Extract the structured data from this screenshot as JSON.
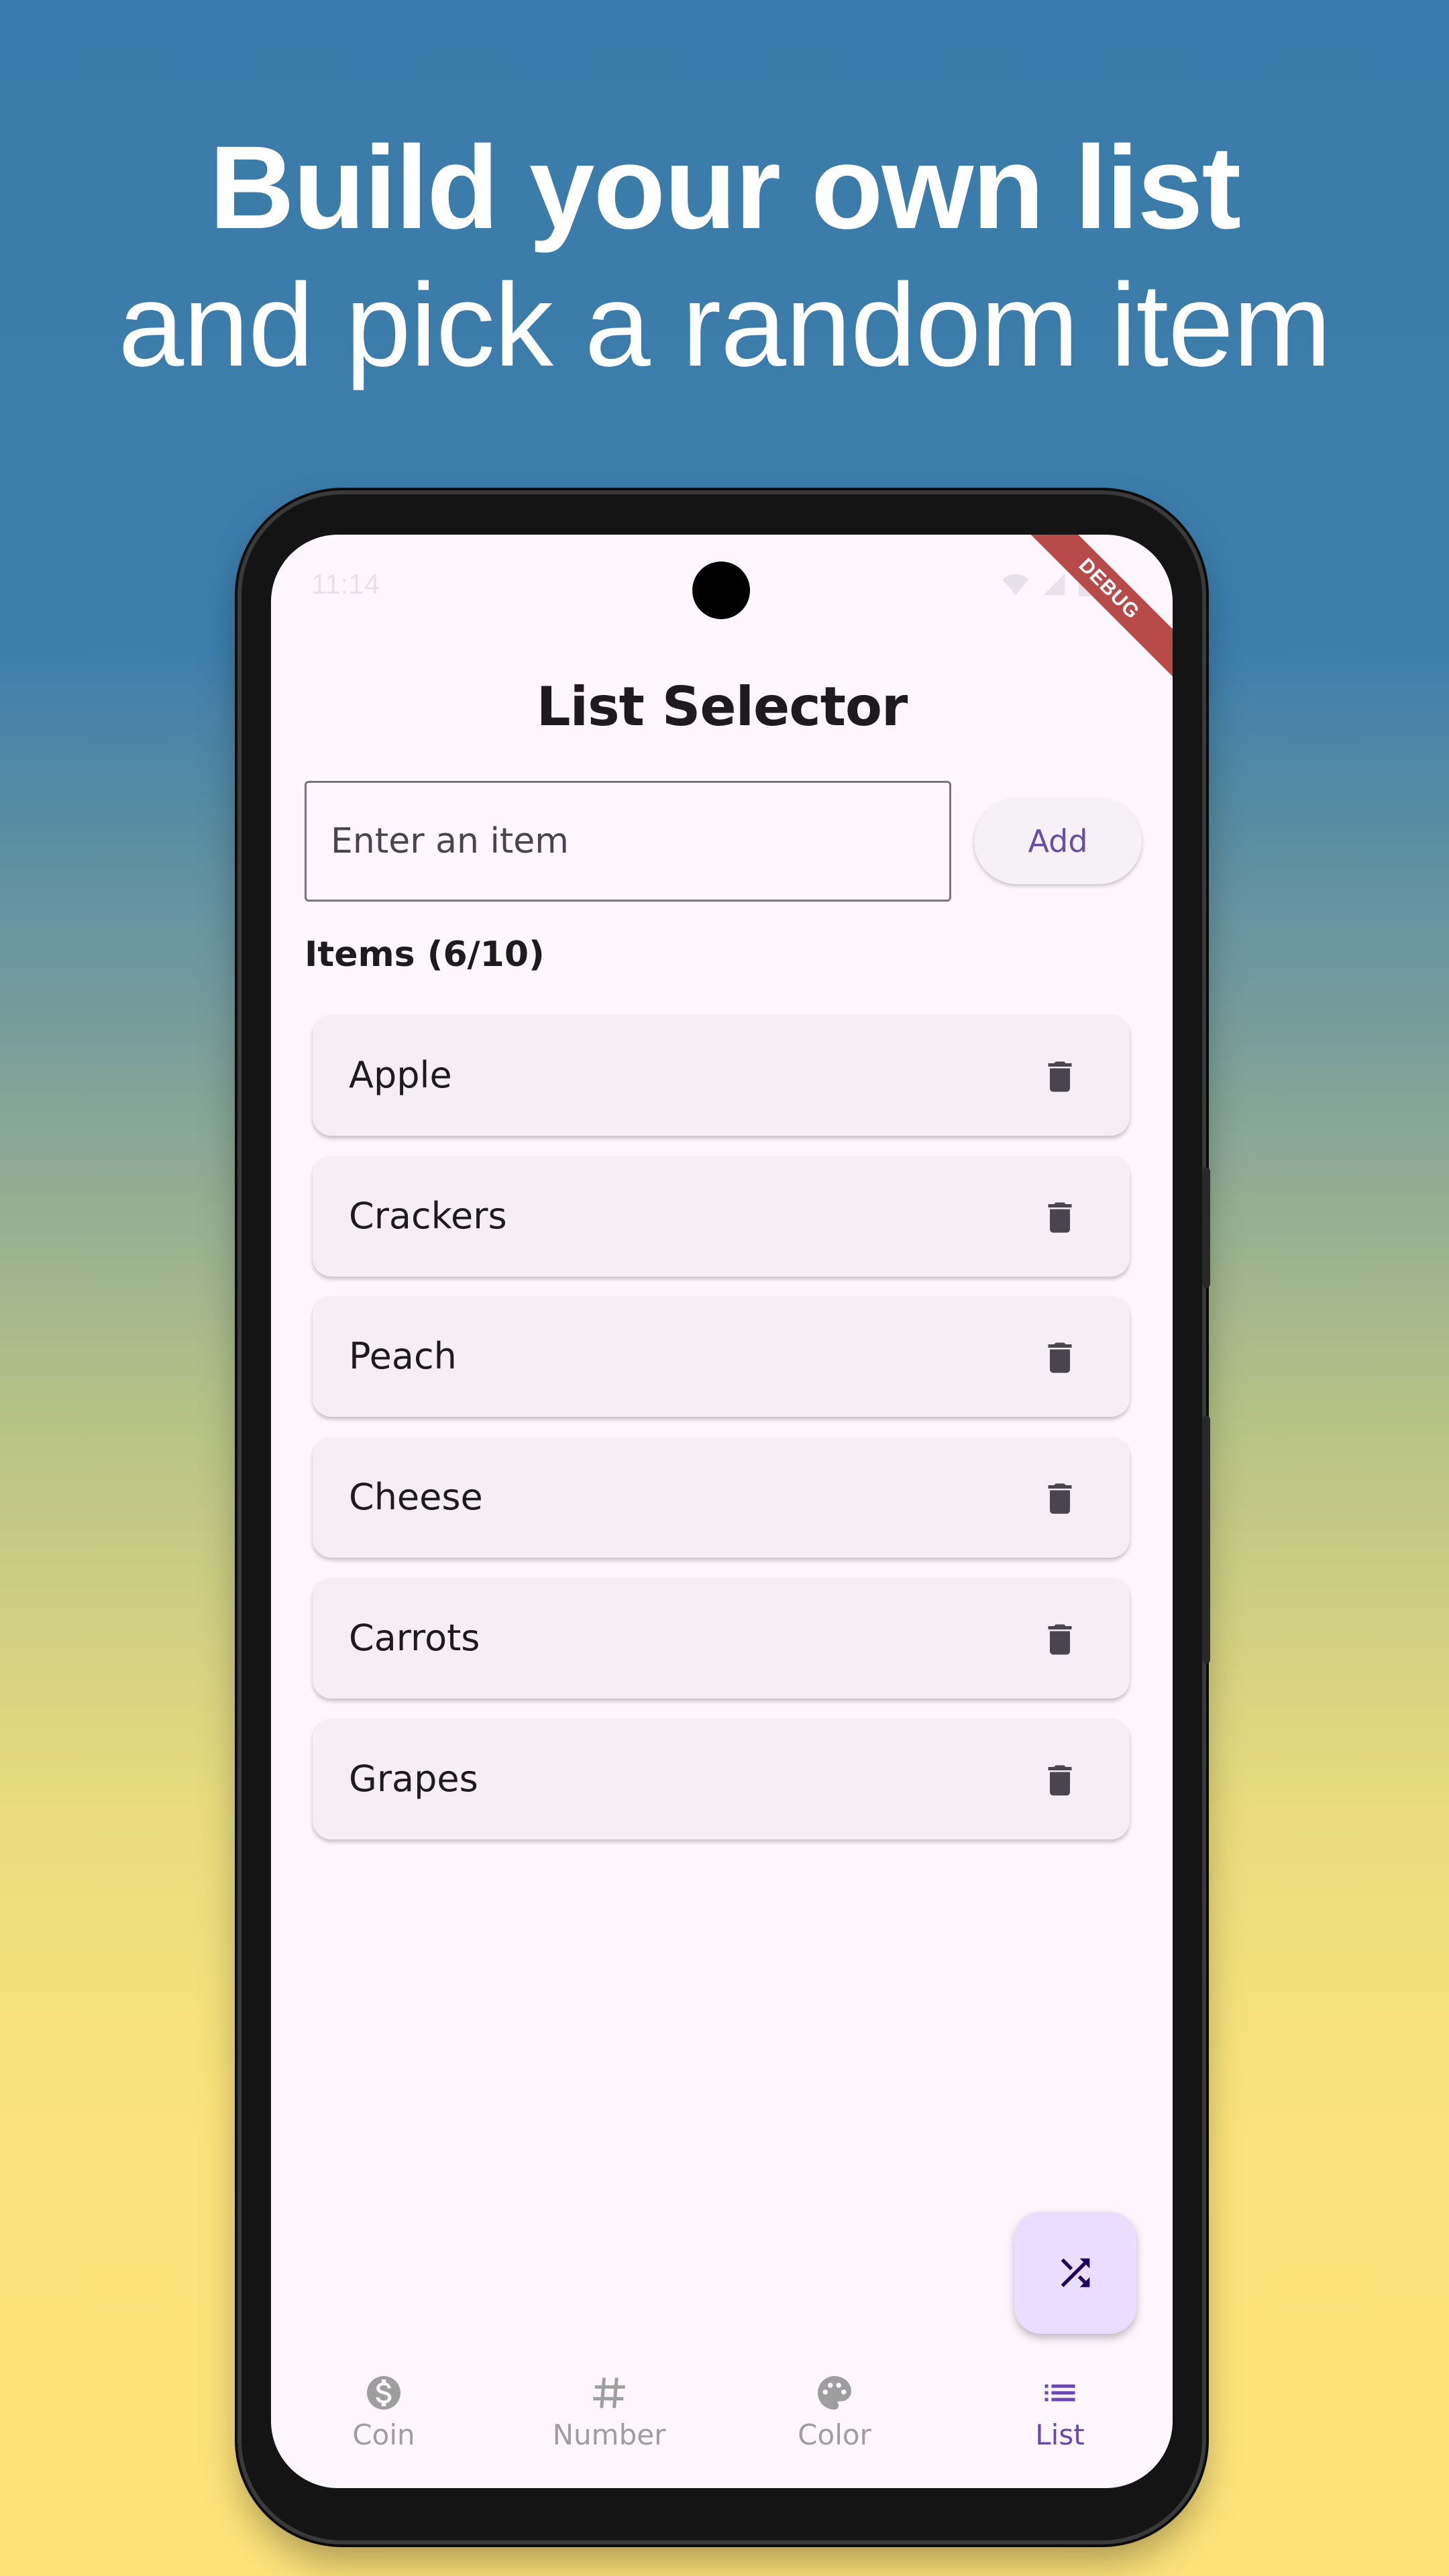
{
  "promo": {
    "headline_bold": "Build your own list",
    "headline_regular": "and pick a random item"
  },
  "status_bar": {
    "time": "11:14"
  },
  "debug_ribbon": "DEBUG",
  "app": {
    "title": "List Selector",
    "input_placeholder": "Enter an item",
    "add_label": "Add",
    "items_count": "Items (6/10)",
    "items": [
      "Apple",
      "Crackers",
      "Peach",
      "Cheese",
      "Carrots",
      "Grapes"
    ]
  },
  "fab": {
    "icon": "shuffle-icon"
  },
  "nav": [
    {
      "label": "Coin",
      "icon": "dollar-coin-icon",
      "active": false
    },
    {
      "label": "Number",
      "icon": "hash-icon",
      "active": false
    },
    {
      "label": "Color",
      "icon": "palette-icon",
      "active": false
    },
    {
      "label": "List",
      "icon": "list-icon",
      "active": true
    }
  ],
  "colors": {
    "accent": "#6a45b8",
    "fab_bg": "#eaddff",
    "card_bg": "#f5eff5",
    "screen_bg": "#fdf7fd",
    "inactive_nav": "#9e9e9e"
  }
}
